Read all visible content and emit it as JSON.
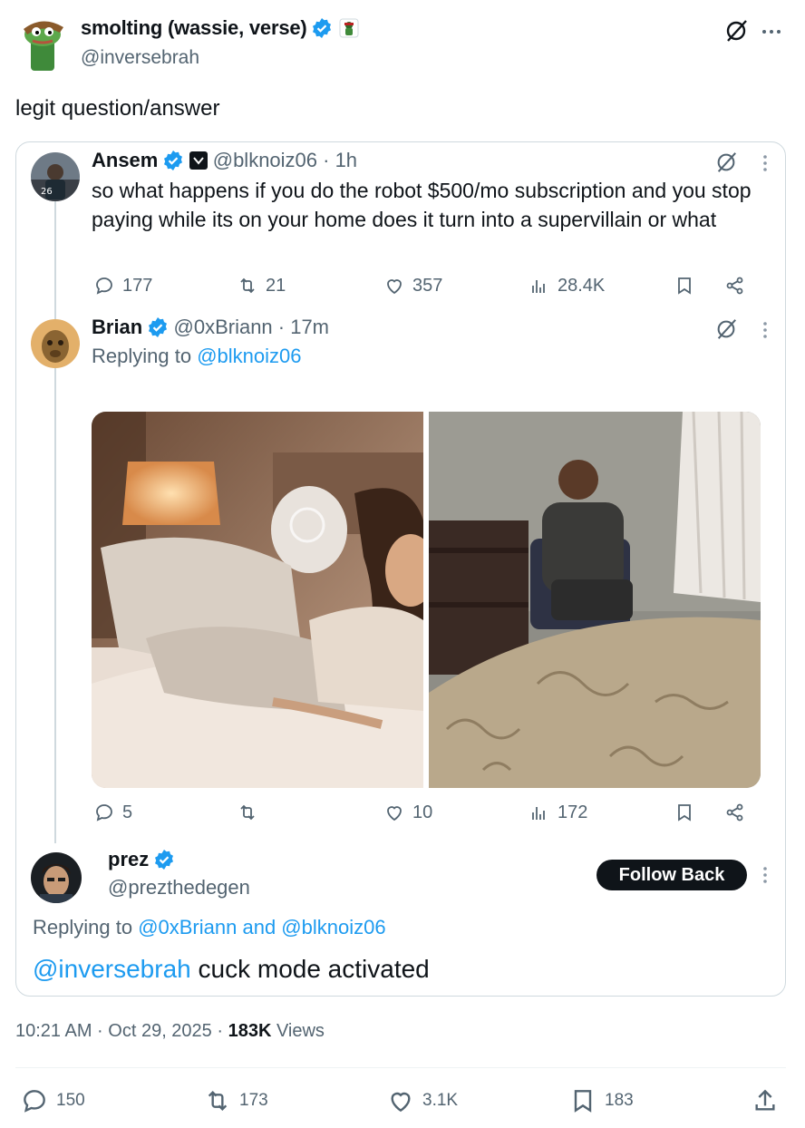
{
  "main_tweet": {
    "display_name": "smolting (wassie, verse)",
    "handle": "@inversebrah",
    "text": "legit question/answer",
    "timestamp": "10:21 AM · Oct 29, 2025 · ",
    "views_count": "183K",
    "views_label": " Views",
    "actions": {
      "replies": "150",
      "reposts": "173",
      "likes": "3.1K",
      "bookmarks": "183"
    }
  },
  "quoted": {
    "post1": {
      "name": "Ansem",
      "handle": "@blknoiz06 · 1h",
      "text": "so what happens if you do the robot $500/mo subscription and you stop paying while its on your home does it turn into a supervillain or what",
      "actions": {
        "replies": "177",
        "reposts": "21",
        "likes": "357",
        "views": "28.4K"
      }
    },
    "post2": {
      "name": "Brian",
      "handle": "@0xBriann · 17m",
      "replying_prefix": "Replying to ",
      "replying_to": "@blknoiz06",
      "actions": {
        "replies": "5",
        "likes": "10",
        "views": "172"
      }
    },
    "post3": {
      "name": "prez",
      "handle": "@prezthedegen",
      "follow_label": "Follow Back",
      "replying_prefix": "Replying to ",
      "replying_1": "@0xBriann",
      "replying_and": " and ",
      "replying_2": "@blknoiz06",
      "mention": "@inversebrah",
      "text": " cuck mode activated"
    }
  },
  "colors": {
    "accent": "#1d9bf0",
    "text": "#0f1419",
    "muted": "#536471",
    "border": "#cfd9de"
  }
}
